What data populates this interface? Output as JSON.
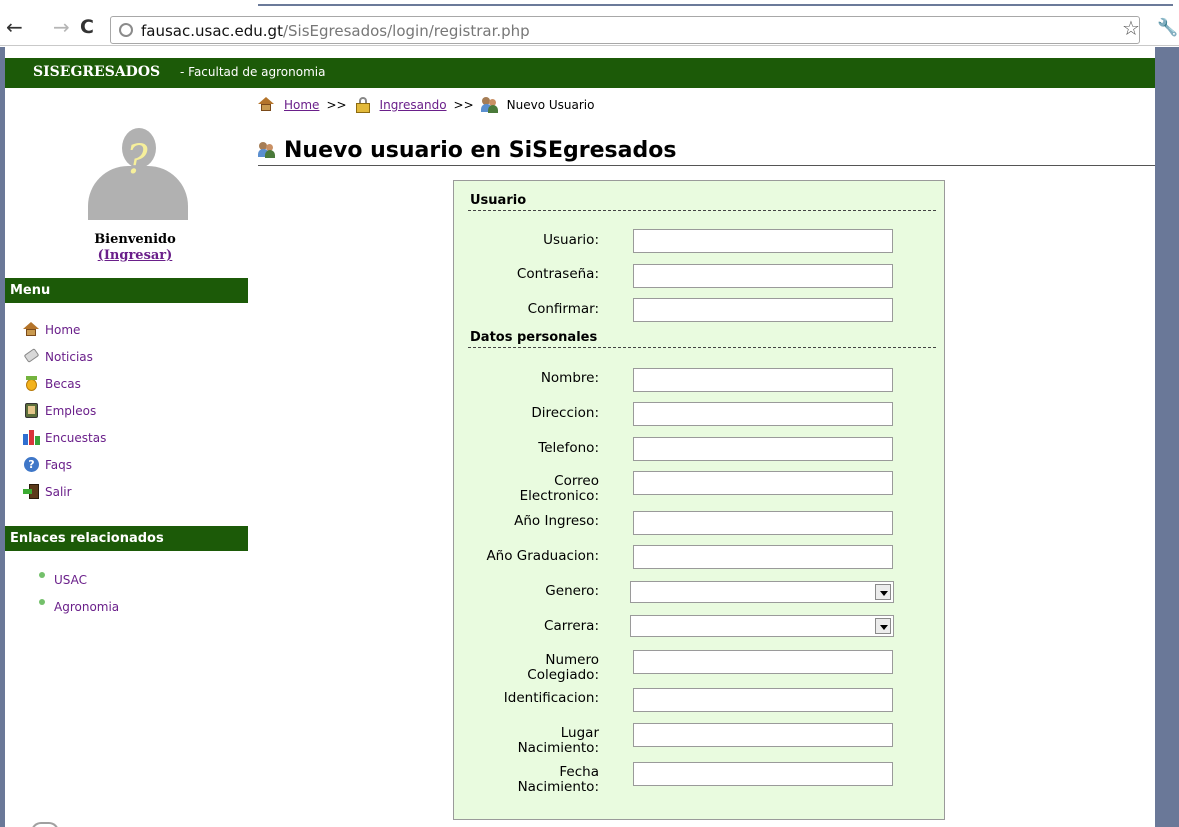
{
  "browser": {
    "url_host": "fausac.usac.edu.gt",
    "url_path": "/SisEgresados/login/registrar.php"
  },
  "header": {
    "title": "SISEGRESADOS",
    "subtitle": "- Facultad de agronomia"
  },
  "sidebar": {
    "welcome": "Bienvenido",
    "login_link": "(Ingresar)",
    "menu_title": "Menu",
    "menu_items": [
      {
        "label": "Home",
        "icon": "home-icon"
      },
      {
        "label": "Noticias",
        "icon": "tag-icon"
      },
      {
        "label": "Becas",
        "icon": "medal-icon"
      },
      {
        "label": "Empleos",
        "icon": "book-icon"
      },
      {
        "label": "Encuestas",
        "icon": "bar-chart-icon"
      },
      {
        "label": "Faqs",
        "icon": "help-icon"
      },
      {
        "label": "Salir",
        "icon": "exit-icon"
      }
    ],
    "links_title": "Enlaces relacionados",
    "links": [
      {
        "label": "USAC"
      },
      {
        "label": "Agronomia"
      }
    ]
  },
  "breadcrumb": {
    "home": "Home",
    "sep": ">>",
    "ingresando": "Ingresando",
    "current": "Nuevo Usuario"
  },
  "page": {
    "title": "Nuevo usuario en SiSEgresados"
  },
  "form": {
    "section_usuario": "Usuario",
    "section_personales": "Datos personales",
    "fields": {
      "usuario": {
        "label": "Usuario:",
        "value": ""
      },
      "contrasena": {
        "label": "Contraseña:",
        "value": ""
      },
      "confirmar": {
        "label": "Confirmar:",
        "value": ""
      },
      "nombre": {
        "label": "Nombre:",
        "value": ""
      },
      "direccion": {
        "label": "Direccion:",
        "value": ""
      },
      "telefono": {
        "label": "Telefono:",
        "value": ""
      },
      "correo": {
        "label_1": "Correo",
        "label_2": "Electronico:",
        "value": ""
      },
      "anio_ingreso": {
        "label": "Año Ingreso:",
        "value": ""
      },
      "anio_graduacion": {
        "label": "Año Graduacion:",
        "value": ""
      },
      "genero": {
        "label": "Genero:",
        "value": ""
      },
      "carrera": {
        "label": "Carrera:",
        "value": ""
      },
      "colegiado": {
        "label_1": "Numero",
        "label_2": "Colegiado:",
        "value": ""
      },
      "identificacion": {
        "label": "Identificacion:",
        "value": ""
      },
      "lugar_nacimiento": {
        "label_1": "Lugar",
        "label_2": "Nacimiento:",
        "value": ""
      },
      "fecha_nacimiento": {
        "label_1": "Fecha",
        "label_2": "Nacimiento:",
        "value": ""
      }
    }
  },
  "colors": {
    "header_green": "#1c5a08",
    "form_bg": "#e9fbdf",
    "link_purple": "#6a1f8a"
  }
}
